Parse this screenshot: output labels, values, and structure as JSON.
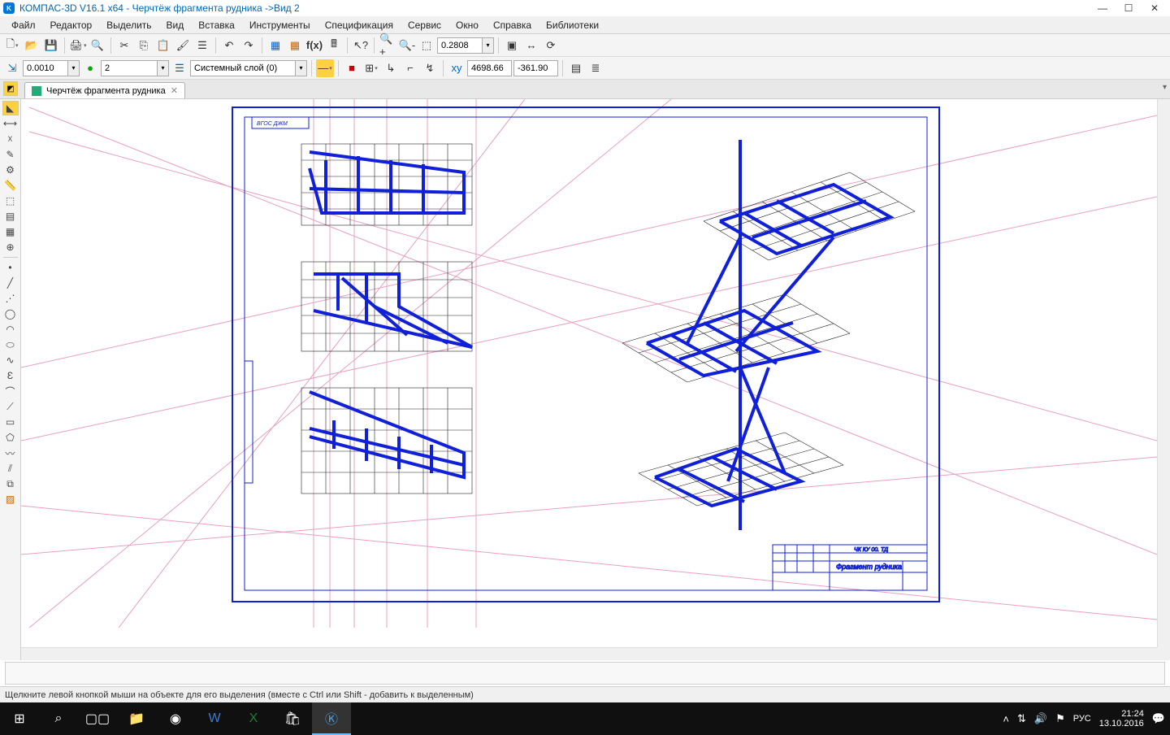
{
  "title": "КОМПАС-3D V16.1 x64 - Черчтёж фрагмента рудника ->Вид 2",
  "menu": [
    "Файл",
    "Редактор",
    "Выделить",
    "Вид",
    "Вставка",
    "Инструменты",
    "Спецификация",
    "Сервис",
    "Окно",
    "Справка",
    "Библиотеки"
  ],
  "toolbar1": {
    "step_value": "0.0010",
    "view_number": "2",
    "layer_label": "Системный слой (0)",
    "zoom_value": "0.2808",
    "coord_x": "4698.66",
    "coord_y": "-361.90"
  },
  "doc_tab": {
    "label": "Черчтёж фрагмента рудника"
  },
  "status": "Щелкните левой кнопкой мыши на объекте для его выделения (вместе с Ctrl или Shift - добавить к выделенным)",
  "taskbar": {
    "lang": "РУС",
    "time": "21:24",
    "date": "13.10.2016"
  },
  "drawing": {
    "titleblock_code": "ЧК КУ 00. ТД",
    "titleblock_name": "Фрагмент рудника",
    "top_label": "ВГОС ДЖМ"
  }
}
